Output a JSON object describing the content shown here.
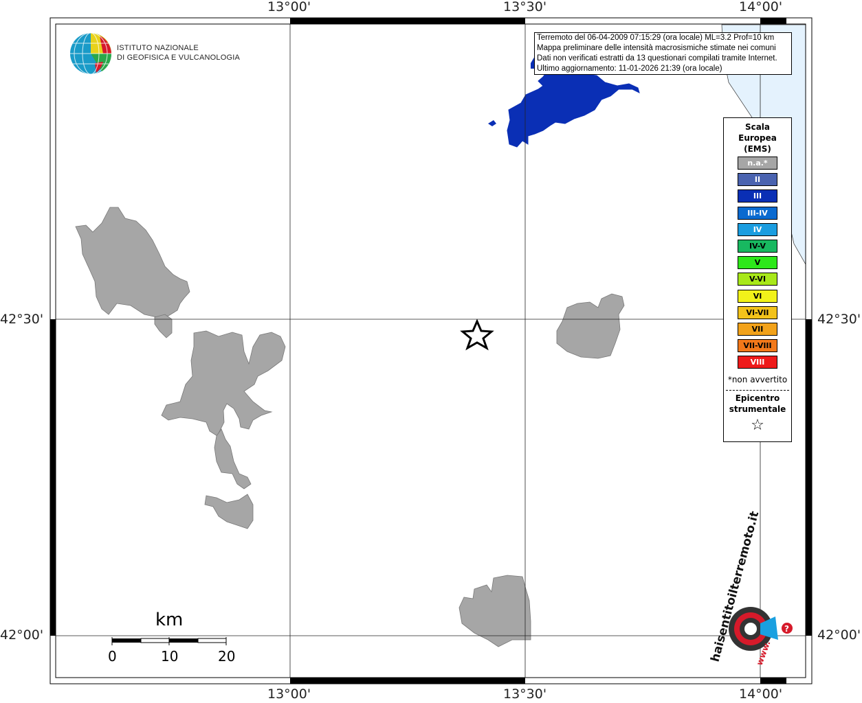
{
  "map": {
    "top_labels": [
      "13°00'",
      "13°30'",
      "14°00'"
    ],
    "bottom_labels": [
      "13°00'",
      "13°30'",
      "14°00'"
    ],
    "left_labels": [
      "42°30'",
      "42°00'"
    ],
    "right_labels": [
      "42°30'",
      "42°00'"
    ],
    "colors": {
      "na": "#a6a6a6",
      "III": "#0a2fb5",
      "sea": "#e4f2fd"
    }
  },
  "inset": {
    "lines": [
      "Terremoto del 06-04-2009 07:15:29 (ora locale) ML=3.2 Prof=10 km",
      "Mappa preliminare delle intensità macrosismiche stimate nei comuni",
      "Dati non verificati estratti da 13 questionari compilati tramite Internet.",
      "Ultimo aggiornamento: 11-01-2026 21:39 (ora locale)"
    ]
  },
  "logo": {
    "line1": "ISTITUTO NAZIONALE",
    "line2": "DI GEOFISICA E VULCANOLOGIA"
  },
  "legend": {
    "title": [
      "Scala",
      "Europea",
      "(EMS)"
    ],
    "items": [
      {
        "label": "n.a.*",
        "color": "#a6a6a6",
        "text": "#ffffff"
      },
      {
        "label": "II",
        "color": "#4a63b0",
        "text": "#ffffff"
      },
      {
        "label": "III",
        "color": "#0a2fb5",
        "text": "#ffffff"
      },
      {
        "label": "III-IV",
        "color": "#0a6ad0",
        "text": "#ffffff"
      },
      {
        "label": "IV",
        "color": "#1a9de0",
        "text": "#ffffff"
      },
      {
        "label": "IV-V",
        "color": "#18b860",
        "text": "#000000"
      },
      {
        "label": "V",
        "color": "#2de81a",
        "text": "#000000"
      },
      {
        "label": "V-VI",
        "color": "#a8e81a",
        "text": "#000000"
      },
      {
        "label": "VI",
        "color": "#f2f21a",
        "text": "#000000"
      },
      {
        "label": "VI-VII",
        "color": "#f2c21a",
        "text": "#000000"
      },
      {
        "label": "VII",
        "color": "#f2a21a",
        "text": "#000000"
      },
      {
        "label": "VII-VIII",
        "color": "#f2781a",
        "text": "#000000"
      },
      {
        "label": "VIII",
        "color": "#ee1a1a",
        "text": "#ffffff"
      }
    ],
    "na_note": "*non avvertito",
    "epicentre": [
      "Epicentro",
      "strumentale"
    ],
    "star": "☆"
  },
  "scale": {
    "unit": "km",
    "ticks": [
      "0",
      "10",
      "20"
    ]
  },
  "hsi_logo": {
    "text": "haisentitoilterremoto.it",
    "www": "www.",
    "question": "?"
  }
}
